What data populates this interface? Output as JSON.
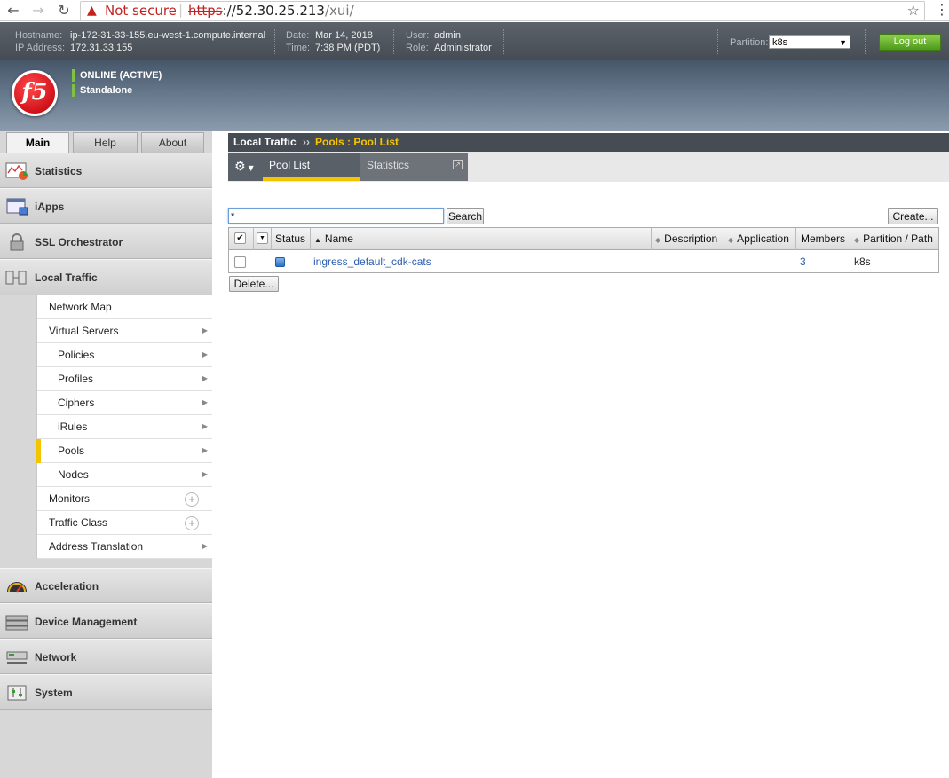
{
  "browser": {
    "not_secure": "Not secure",
    "url_scheme": "https",
    "url_host": "://52.30.25.213",
    "url_path": "/xui/"
  },
  "header": {
    "hostname_label": "Hostname:",
    "hostname": "ip-172-31-33-155.eu-west-1.compute.internal",
    "ip_label": "IP Address:",
    "ip": "172.31.33.155",
    "date_label": "Date:",
    "date": "Mar 14, 2018",
    "time_label": "Time:",
    "time": "7:38 PM (PDT)",
    "user_label": "User:",
    "user": "admin",
    "role_label": "Role:",
    "role": "Administrator",
    "partition_label": "Partition:",
    "partition_value": "k8s",
    "logout": "Log out"
  },
  "banner": {
    "logo": "f5",
    "status": "ONLINE (ACTIVE)",
    "mode": "Standalone",
    "status_color": "#7fc241"
  },
  "tabs": [
    "Main",
    "Help",
    "About"
  ],
  "nav": {
    "sections": [
      {
        "label": "Statistics",
        "icon": "statistics-icon"
      },
      {
        "label": "iApps",
        "icon": "iapps-icon"
      },
      {
        "label": "SSL Orchestrator",
        "icon": "lock-icon"
      },
      {
        "label": "Local Traffic",
        "icon": "local-traffic-icon"
      },
      {
        "label": "Acceleration",
        "icon": "gauge-icon"
      },
      {
        "label": "Device Management",
        "icon": "device-icon"
      },
      {
        "label": "Network",
        "icon": "network-icon"
      },
      {
        "label": "System",
        "icon": "system-icon"
      }
    ],
    "local_traffic_items": [
      {
        "label": "Network Map"
      },
      {
        "label": "Virtual Servers"
      },
      {
        "label": "Policies"
      },
      {
        "label": "Profiles"
      },
      {
        "label": "Ciphers"
      },
      {
        "label": "iRules"
      },
      {
        "label": "Pools"
      },
      {
        "label": "Nodes"
      },
      {
        "label": "Monitors"
      },
      {
        "label": "Traffic Class"
      },
      {
        "label": "Address Translation"
      }
    ]
  },
  "breadcrumb": {
    "section": "Local Traffic",
    "separator": "››",
    "current": "Pools : Pool List"
  },
  "subtabs": [
    "Pool List",
    "Statistics"
  ],
  "search": {
    "value": "*",
    "button": "Search",
    "create": "Create..."
  },
  "table": {
    "columns": [
      "Status",
      "Name",
      "Description",
      "Application",
      "Members",
      "Partition / Path"
    ],
    "rows": [
      {
        "name": "ingress_default_cdk-cats",
        "description": "",
        "application": "",
        "members": "3",
        "partition": "k8s"
      }
    ]
  },
  "delete_button": "Delete...",
  "colors": {
    "accent": "#f4c400",
    "header_dark": "#464c53",
    "link": "#2a5db0"
  }
}
